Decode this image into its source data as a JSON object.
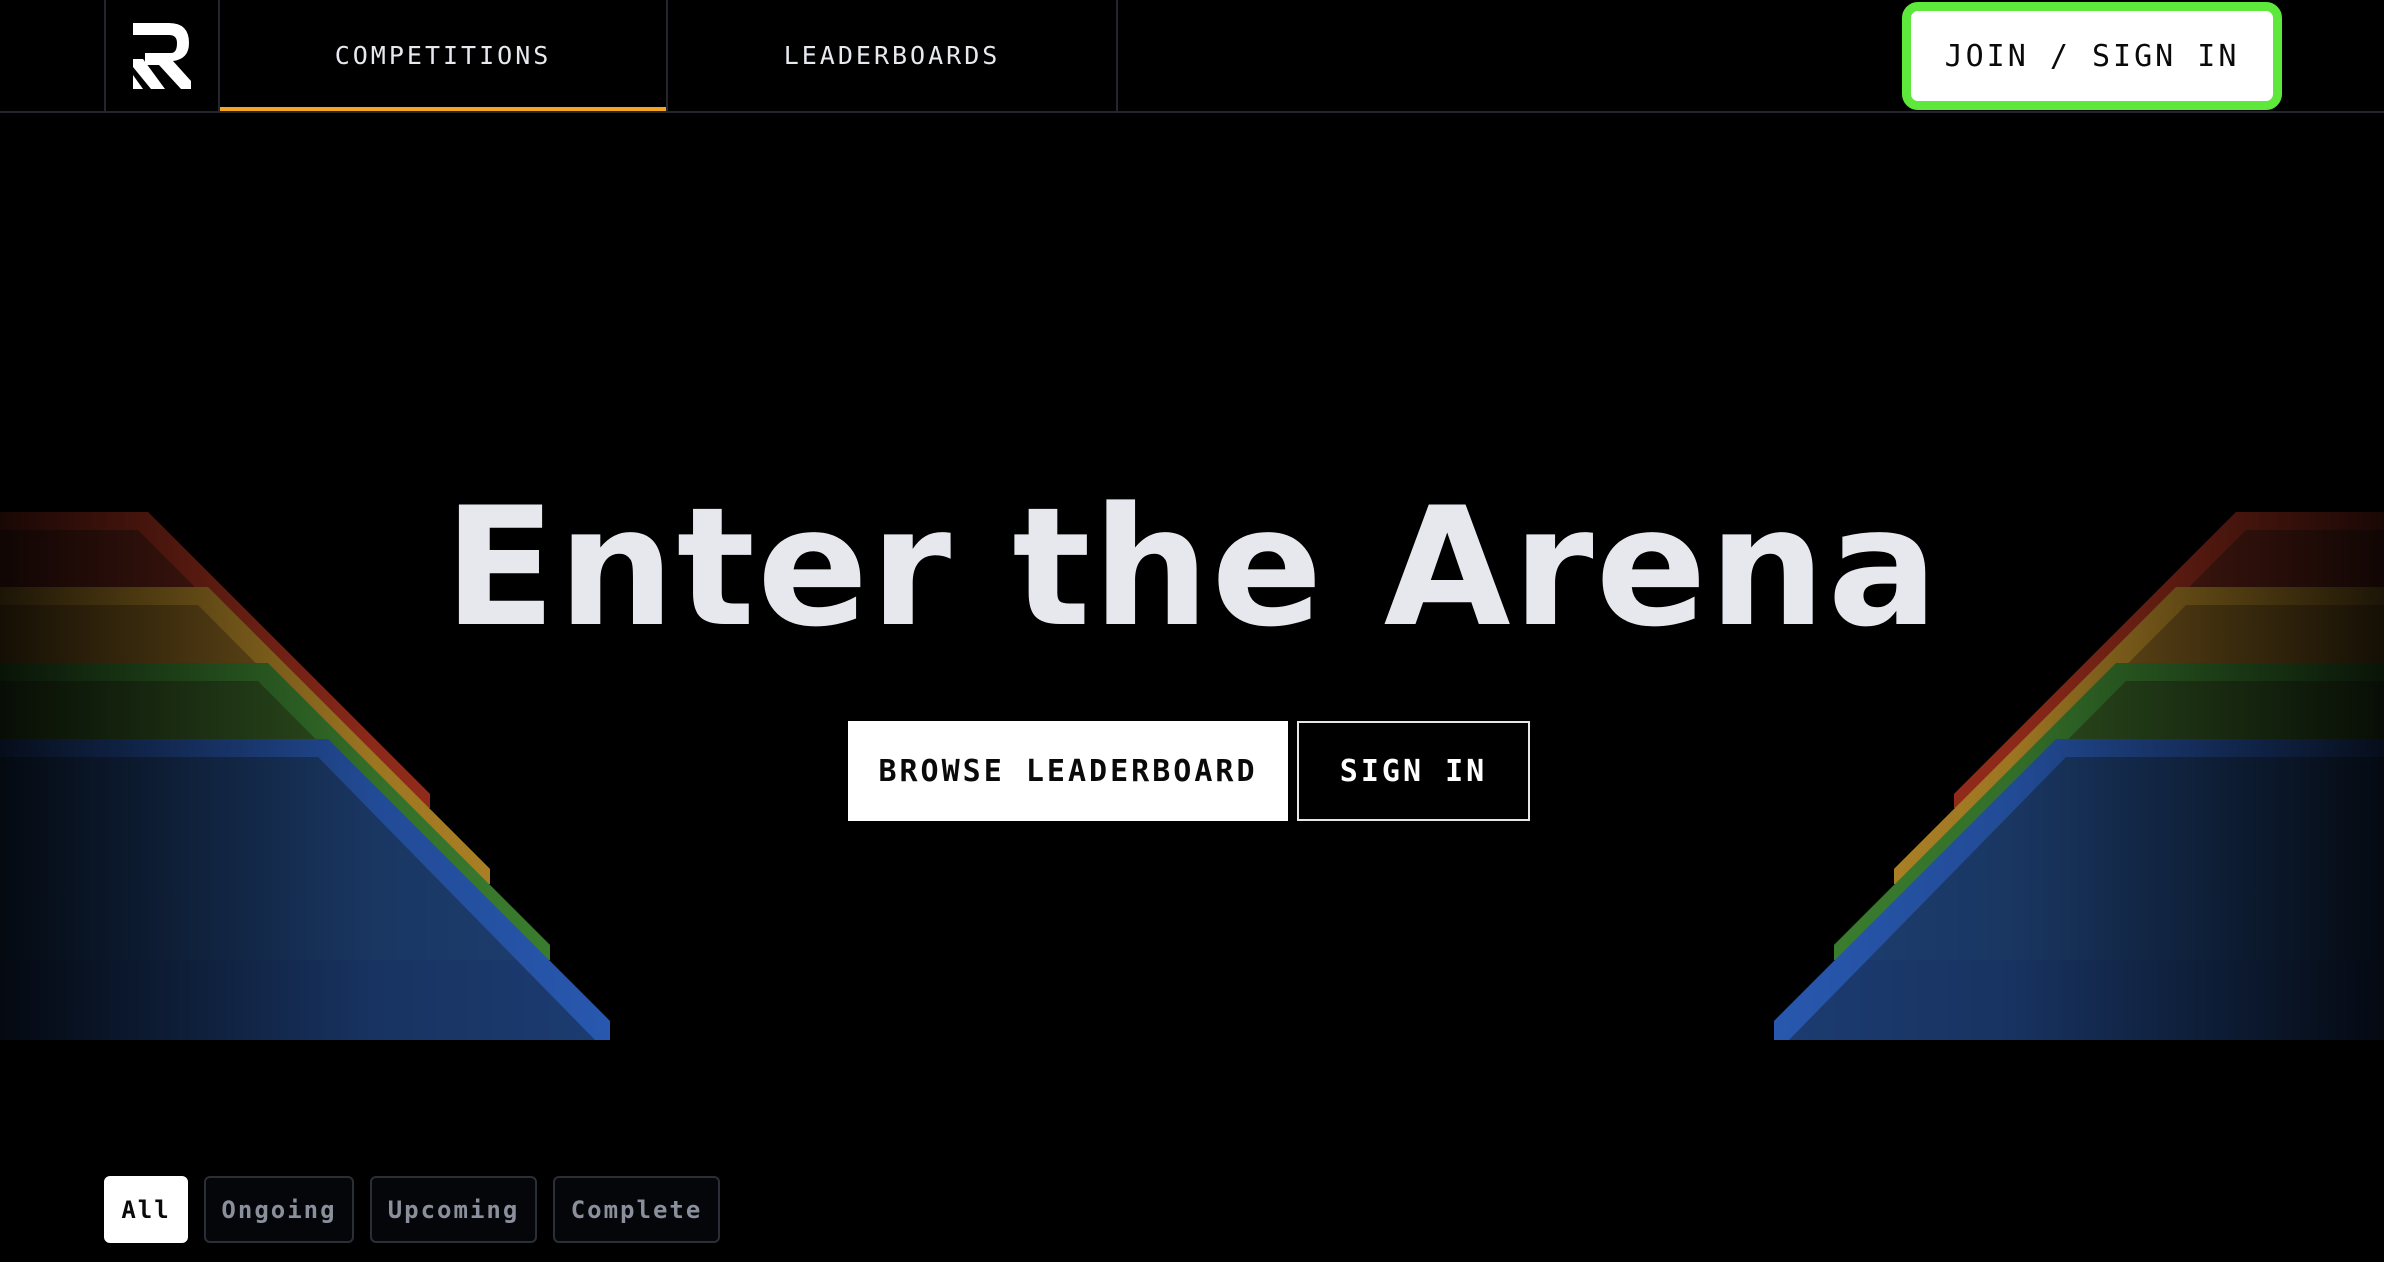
{
  "nav": {
    "logo_icon": "brand-r-logo-icon",
    "tabs": [
      {
        "label": "COMPETITIONS",
        "active": true
      },
      {
        "label": "LEADERBOARDS",
        "active": false
      }
    ],
    "join_label": "JOIN / SIGN IN",
    "active_tab_color": "#f5a524",
    "join_highlight_color": "#5ee83c"
  },
  "hero": {
    "title": "Enter the Arena",
    "browse_label": "BROWSE LEADERBOARD",
    "signin_label": "SIGN IN",
    "stripe_colors": [
      "#b8321f",
      "#c9912a",
      "#3f8a2e",
      "#2a5fb8"
    ]
  },
  "filters": {
    "items": [
      {
        "label": "All",
        "active": true
      },
      {
        "label": "Ongoing",
        "active": false
      },
      {
        "label": "Upcoming",
        "active": false
      },
      {
        "label": "Complete",
        "active": false
      }
    ]
  }
}
